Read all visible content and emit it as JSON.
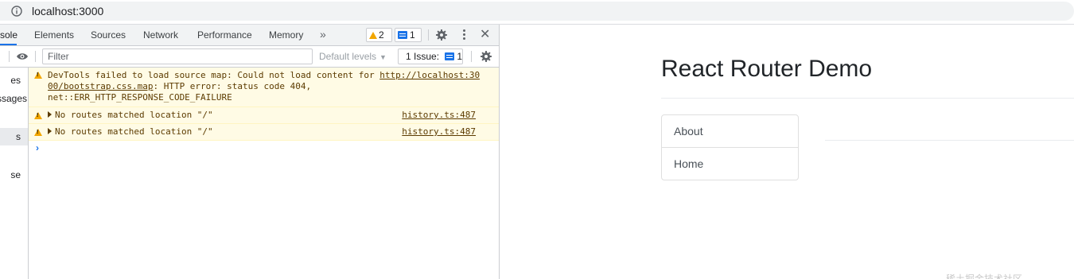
{
  "browser": {
    "url": "localhost:3000",
    "info_icon": "info-circle-icon"
  },
  "devtools": {
    "tabs": [
      {
        "label": "Console",
        "visible_label": "sole",
        "active": true
      },
      {
        "label": "Elements"
      },
      {
        "label": "Sources"
      },
      {
        "label": "Network"
      },
      {
        "label": "Performance"
      },
      {
        "label": "Memory"
      }
    ],
    "more_tabs": "»",
    "warning_count": "2",
    "message_count": "1",
    "toolbar": {
      "filter_placeholder": "Filter",
      "default_levels": "Default levels",
      "issues_label": "1 Issue:",
      "issues_count": "1"
    },
    "sidebar": {
      "items": [
        "es",
        "ssages",
        "s",
        "se"
      ]
    },
    "console": {
      "messages": [
        {
          "level": "warning",
          "line1_prefix": "DevTools failed to load source map: Could not load content for ",
          "link_part1": "http://localhost:30",
          "link_part2": "00/bootstrap.css.map",
          "line2_suffix": ": HTTP error: status code 404,",
          "line3": "net::ERR_HTTP_RESPONSE_CODE_FAILURE"
        },
        {
          "level": "warning",
          "text": "No routes matched location \"/\"",
          "source": "history.ts:487"
        },
        {
          "level": "warning",
          "text": "No routes matched location \"/\"",
          "source": "history.ts:487"
        }
      ],
      "prompt": "›"
    },
    "colors": {
      "warning_bg": "#fffbe5",
      "warning_text": "#5c3b00",
      "accent": "#1a73e8",
      "warning_icon": "#f2a600"
    }
  },
  "page": {
    "title": "React Router Demo",
    "nav": [
      {
        "label": "About"
      },
      {
        "label": "Home"
      }
    ]
  }
}
